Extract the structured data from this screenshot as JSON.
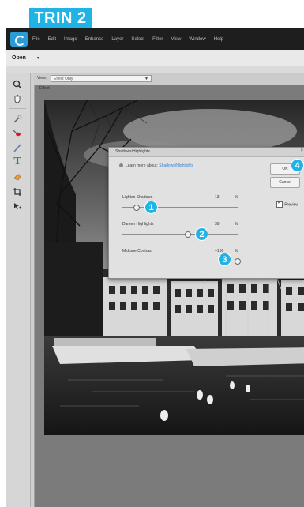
{
  "step_label": "TRIN 2",
  "menu": [
    "File",
    "Edit",
    "Image",
    "Enhance",
    "Layer",
    "Select",
    "Filter",
    "View",
    "Window",
    "Help"
  ],
  "toolbar": {
    "open_label": "Open",
    "open_arrow": "▾"
  },
  "view_bar": {
    "label": "View:",
    "selected": "Effect Only"
  },
  "panel_label": "Effect",
  "dialog": {
    "title": "Shadows/Highlights",
    "close": "×",
    "learn_text": "Learn more about:",
    "learn_link": "Shadows/Highlights",
    "ok_label": "OK",
    "cancel_label": "Cancel",
    "preview_label": "Preview",
    "preview_checked": true,
    "sliders": [
      {
        "label": "Lighten Shadows",
        "value": "13",
        "unit": "%",
        "position": 0.12
      },
      {
        "label": "Darken Highlights",
        "value": "39",
        "unit": "%",
        "position": 0.57
      },
      {
        "label": "Midtone Contrast",
        "value": "+100",
        "unit": "%",
        "position": 1.0
      }
    ]
  },
  "markers": [
    "1",
    "2",
    "3",
    "4"
  ],
  "colors": {
    "accent": "#1fb3e6",
    "menubar": "#1e1e1e",
    "link": "#3a7fd5"
  },
  "tools": [
    "zoom-icon",
    "hand-icon",
    "quick-select-icon",
    "red-eye-icon",
    "brush-icon",
    "type-icon",
    "eraser-icon",
    "crop-icon",
    "move-icon"
  ]
}
